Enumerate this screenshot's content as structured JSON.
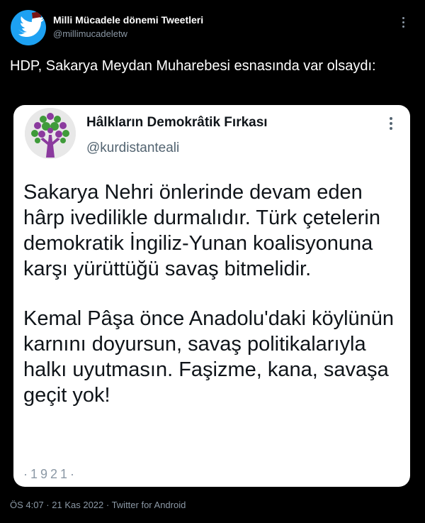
{
  "author": {
    "name": "Milli Mücadele dönemi Tweetleri",
    "handle": "@millimucadeletw"
  },
  "tweet": {
    "text": "HDP, Sakarya Meydan Muharebesi esnasında var olsaydı:"
  },
  "embedded": {
    "name": "Hâlkların Demokrâtik Fırkası",
    "handle": "@kurdistanteali",
    "paragraph1": "Sakarya Nehri önlerinde devam eden hârp ivedilikle durmalıdır. Türk çetelerin demokratik İngiliz-Yunan koalisyonuna karşı yürüttüğü savaş bitmelidir.",
    "paragraph2": "Kemal Pâşa önce Anadolu'daki köylünün karnını doyursun, savaş politikalarıyla halkı uyutmasın. Faşizme, kana, savaşa geçit yok!",
    "date": "·1921·"
  },
  "meta": {
    "text": "ÖS 4:07 · 21 Kas 2022 · Twitter for Android"
  },
  "colors": {
    "background": "#000000",
    "avatar_blue": "#1da1f2",
    "card_background": "#ffffff",
    "muted": "#8b98a5",
    "tree_purple": "#8b3a9e",
    "tree_green": "#3f9b3a"
  },
  "icons": {
    "author_avatar": "twitter-bird-with-fez-icon",
    "embedded_avatar": "tree-logo-icon",
    "more": "more-options-icon"
  }
}
